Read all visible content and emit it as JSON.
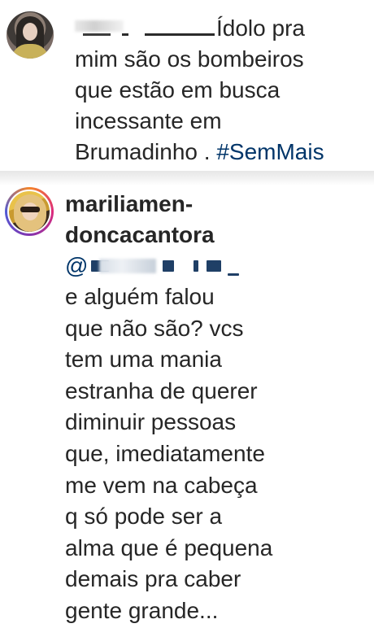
{
  "comment1": {
    "avatar": "user-avatar",
    "text_line1": "Ídolo pra",
    "text_line2": "mim são os bombeiros",
    "text_line3": "que estão em busca",
    "text_line4": "incessante em",
    "text_line5": "Brumadinho . ",
    "hashtag": "#SemMais"
  },
  "comment2": {
    "avatar": "marilia-avatar",
    "username_line1": "mariliamen-",
    "username_line2": "doncacantora",
    "mention_prefix": "@",
    "body_lines": [
      "e alguém falou",
      "que não são? vcs",
      "tem uma mania",
      "estranha de querer",
      "diminuir pessoas",
      "que, imediatamente",
      "me vem na cabeça",
      "q só pode ser a",
      "alma que é pequena",
      "demais pra caber",
      "gente grande..."
    ]
  },
  "colors": {
    "text": "#262626",
    "link": "#003569",
    "story_ring": "#dd2a7b"
  }
}
